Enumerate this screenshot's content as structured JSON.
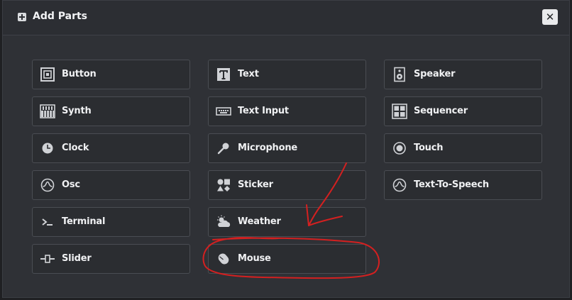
{
  "dialog": {
    "title": "Add Parts",
    "close_label": "✕"
  },
  "parts": [
    {
      "label": "Button",
      "icon": "button-icon"
    },
    {
      "label": "Text",
      "icon": "text-icon"
    },
    {
      "label": "Speaker",
      "icon": "speaker-icon"
    },
    {
      "label": "Synth",
      "icon": "synth-icon"
    },
    {
      "label": "Text Input",
      "icon": "text-input-icon"
    },
    {
      "label": "Sequencer",
      "icon": "sequencer-icon"
    },
    {
      "label": "Clock",
      "icon": "clock-icon"
    },
    {
      "label": "Microphone",
      "icon": "microphone-icon"
    },
    {
      "label": "Touch",
      "icon": "touch-icon"
    },
    {
      "label": "Osc",
      "icon": "osc-icon"
    },
    {
      "label": "Sticker",
      "icon": "sticker-icon"
    },
    {
      "label": "Text-To-Speech",
      "icon": "text-to-speech-icon"
    },
    {
      "label": "Terminal",
      "icon": "terminal-icon"
    },
    {
      "label": "Weather",
      "icon": "weather-icon"
    },
    {
      "label": "Slider",
      "icon": "slider-icon"
    },
    {
      "label": "Mouse",
      "icon": "mouse-icon"
    }
  ],
  "annotation_color": "#d42020"
}
